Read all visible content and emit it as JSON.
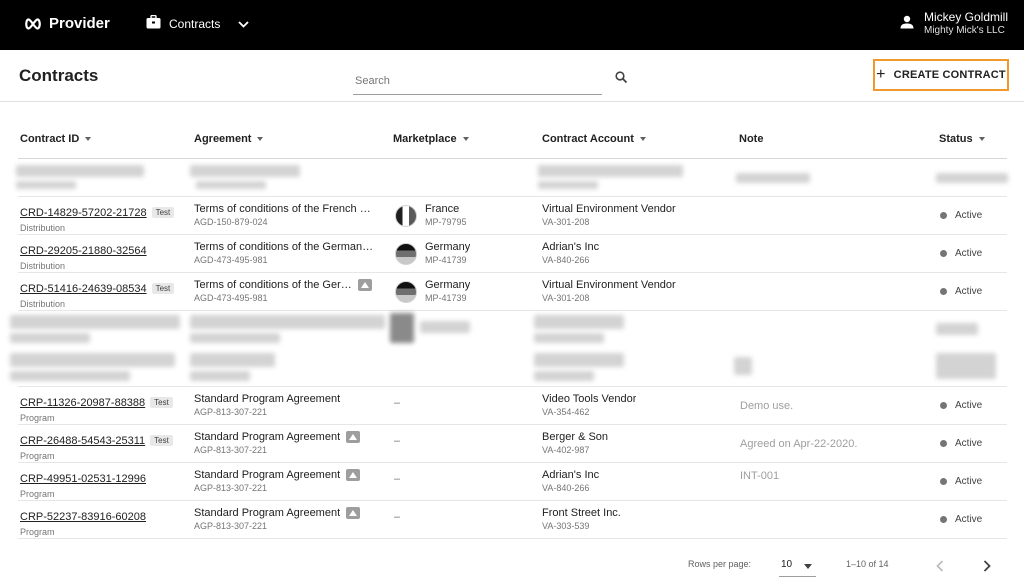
{
  "topbar": {
    "brand": "Provider",
    "module": "Contracts",
    "user_name": "Mickey Goldmill",
    "user_org": "Mighty Mick's LLC"
  },
  "page": {
    "title": "Contracts",
    "search_placeholder": "Search",
    "create_label": "CREATE CONTRACT"
  },
  "columns": {
    "contract_id": "Contract ID",
    "agreement": "Agreement",
    "marketplace": "Marketplace",
    "contract_account": "Contract Account",
    "note": "Note",
    "status": "Status"
  },
  "rows": [
    {
      "id": "CRD-14829-57202-21728",
      "tag": "Test",
      "type": "Distribution",
      "agreement": "Terms of conditions of the French …",
      "agreement_id": "AGD-150-879-024",
      "marketplace": "France",
      "marketplace_id": "MP-79795",
      "account": "Virtual Environment Vendor",
      "account_id": "VA-301-208",
      "note": "",
      "status": "Active"
    },
    {
      "id": "CRD-29205-21880-32564",
      "tag": "",
      "type": "Distribution",
      "agreement": "Terms of conditions of the German…",
      "agreement_id": "AGD-473-495-981",
      "marketplace": "Germany",
      "marketplace_id": "MP-41739",
      "account": "Adrian's Inc",
      "account_id": "VA-840-266",
      "note": "",
      "status": "Active"
    },
    {
      "id": "CRD-51416-24639-08534",
      "tag": "Test",
      "type": "Distribution",
      "agreement": "Terms of conditions of the Ger…",
      "agreement_id": "AGD-473-495-981",
      "marketplace": "Germany",
      "marketplace_id": "MP-41739",
      "account": "Virtual Environment Vendor",
      "account_id": "VA-301-208",
      "note": "",
      "status": "Active"
    },
    {
      "id": "CRP-11326-20987-88388",
      "tag": "Test",
      "type": "Program",
      "agreement": "Standard Program Agreement",
      "agreement_id": "AGP-813-307-221",
      "marketplace": "–",
      "marketplace_id": "",
      "account": "Video Tools Vendor",
      "account_id": "VA-354-462",
      "note": "Demo use.",
      "status": "Active"
    },
    {
      "id": "CRP-26488-54543-25311",
      "tag": "Test",
      "type": "Program",
      "agreement": "Standard Program Agreement",
      "agreement_id": "AGP-813-307-221",
      "marketplace": "–",
      "marketplace_id": "",
      "account": "Berger & Son",
      "account_id": "VA-402-987",
      "note": "Agreed on Apr-22-2020.",
      "status": "Active"
    },
    {
      "id": "CRP-49951-02531-12996",
      "tag": "",
      "type": "Program",
      "agreement": "Standard Program Agreement",
      "agreement_id": "AGP-813-307-221",
      "marketplace": "–",
      "marketplace_id": "",
      "account": "Adrian's Inc",
      "account_id": "VA-840-266",
      "note": "INT-001",
      "status": "Active"
    },
    {
      "id": "CRP-52237-83916-60208",
      "tag": "",
      "type": "Program",
      "agreement": "Standard Program Agreement",
      "agreement_id": "AGP-813-307-221",
      "marketplace": "–",
      "marketplace_id": "",
      "account": "Front Street Inc.",
      "account_id": "VA-303-539",
      "note": "",
      "status": "Active"
    }
  ],
  "pagination": {
    "rows_per_page_label": "Rows per page:",
    "rows_per_page": "10",
    "range": "1–10 of 14"
  }
}
